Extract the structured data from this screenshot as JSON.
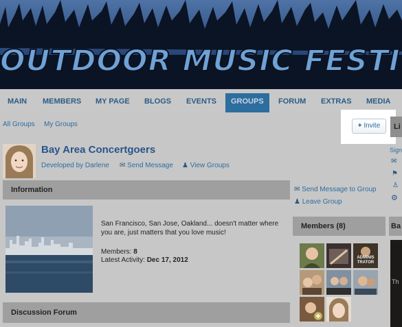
{
  "banner": {
    "title": "OUTDOOR MUSIC FESTIVALS"
  },
  "nav": {
    "items": [
      {
        "label": "MAIN",
        "active": false
      },
      {
        "label": "MEMBERS",
        "active": false
      },
      {
        "label": "MY PAGE",
        "active": false
      },
      {
        "label": "BLOGS",
        "active": false
      },
      {
        "label": "EVENTS",
        "active": false
      },
      {
        "label": "GROUPS",
        "active": true
      },
      {
        "label": "FORUM",
        "active": false
      },
      {
        "label": "EXTRAS",
        "active": false
      },
      {
        "label": "MEDIA",
        "active": false
      }
    ]
  },
  "subnav": {
    "all_groups": "All Groups",
    "my_groups": "My Groups"
  },
  "invite": {
    "icon": "plus-icon",
    "label": "Invite"
  },
  "right_tab": {
    "label": "Li"
  },
  "group": {
    "title": "Bay Area Concertgoers",
    "developed_by": "Developed by Darlene",
    "send_message": "Send Message",
    "view_groups": "View Groups"
  },
  "info": {
    "heading": "Information",
    "description": "San Francisco, San Jose, Oakland... doesn't matter where you are, just matters that you love music!",
    "members_label": "Members:",
    "members_value": "8",
    "activity_label": "Latest Activity:",
    "activity_value": "Dec 17, 2012"
  },
  "actions": {
    "send_message_to_group": "Send Message to Group",
    "leave_group": "Leave Group"
  },
  "members": {
    "heading": "Members (8)",
    "admin_label": "ADMINIS TRATOR"
  },
  "discussion": {
    "heading": "Discussion Forum"
  },
  "right_edge": {
    "sign": "Sign",
    "ba": "Ba",
    "th": "Th"
  },
  "colors": {
    "link": "#2e6ca0",
    "nav_active": "#2d6e9e",
    "section_bar": "#9f9f9f",
    "page_bg": "#c7c7c7"
  }
}
